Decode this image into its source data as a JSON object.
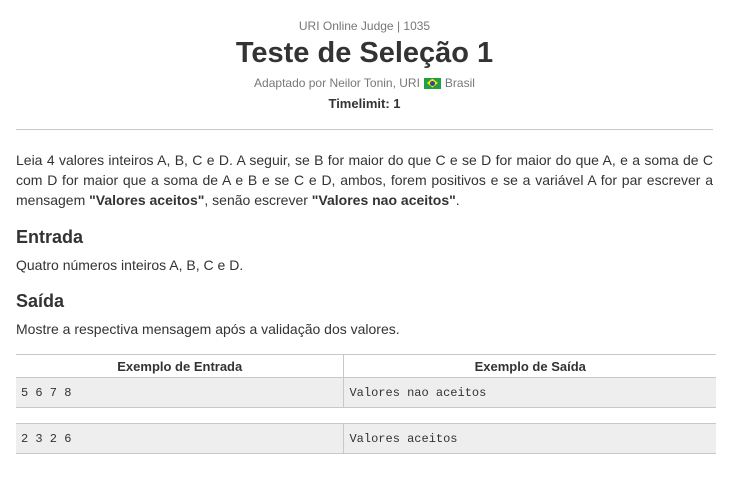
{
  "header": {
    "judge": "URI Online Judge | 1035",
    "title": "Teste de Seleção 1",
    "author_prefix": "Adaptado por Neilor Tonin, URI",
    "author_country": "Brasil",
    "flag_icon": "brazil-flag-icon",
    "timelimit": "Timelimit: 1"
  },
  "description": {
    "part1": "Leia 4 valores inteiros A, B, C e D. A seguir, se B for maior do que C e se D for maior do que A, e a soma de C com D for maior que a soma de A e B e se C e D, ambos, forem positivos e se a variável A for par escrever a mensagem ",
    "accepted": "\"Valores aceitos\"",
    "part2": ", senão escrever ",
    "rejected": "\"Valores nao aceitos\"",
    "part3": "."
  },
  "input_section": {
    "heading": "Entrada",
    "text": "Quatro números inteiros A, B, C e D."
  },
  "output_section": {
    "heading": "Saída",
    "text": "Mostre a respectiva mensagem após a validação dos valores."
  },
  "examples": {
    "input_header": "Exemplo de Entrada",
    "output_header": "Exemplo de Saída",
    "rows": [
      {
        "input": "5 6 7 8",
        "output": "Valores nao aceitos"
      },
      {
        "input": "2 3 2 6",
        "output": "Valores aceitos"
      }
    ]
  }
}
